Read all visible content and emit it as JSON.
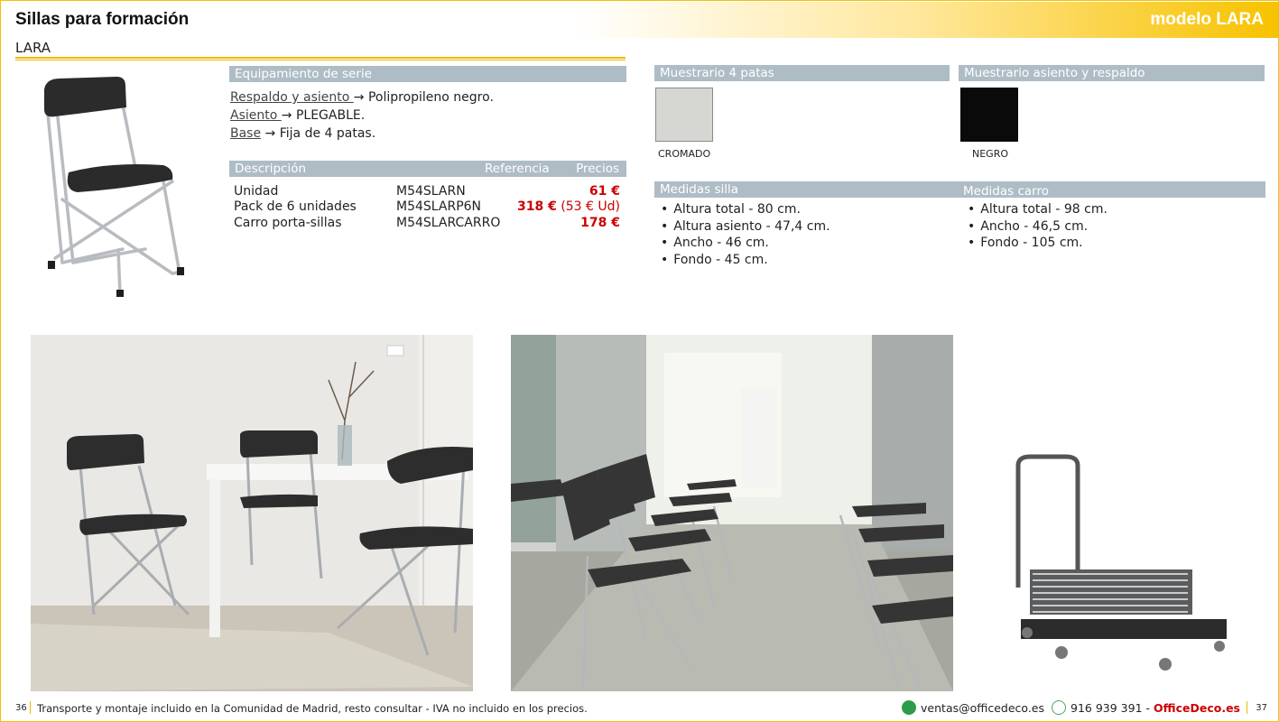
{
  "header": {
    "title": "Sillas para formación",
    "model": "modelo LARA"
  },
  "subtitle": "LARA",
  "equipment": {
    "heading": "Equipamiento de serie",
    "items": [
      {
        "label": "Respaldo y asiento ",
        "arrow": "→",
        "value": "Polipropileno negro."
      },
      {
        "label": "Asiento ",
        "arrow": "→",
        "value": "PLEGABLE."
      },
      {
        "label": "Base",
        "arrow": "→",
        "value": "Fija de 4 patas."
      }
    ]
  },
  "price_table": {
    "headers": {
      "description": "Descripción",
      "reference": "Referencia",
      "prices": "Precios"
    },
    "rows": [
      {
        "description": "Unidad",
        "reference": "M54SLARN",
        "price": "61 €",
        "unit_price": ""
      },
      {
        "description": "Pack de 6 unidades",
        "reference": "M54SLARP6N",
        "price": "318 €",
        "unit_price": "(53 € Ud)"
      },
      {
        "description": "Carro porta-sillas",
        "reference": "M54SLARCARRO",
        "price": "178 €",
        "unit_price": ""
      }
    ]
  },
  "swatches": {
    "legs": {
      "heading": "Muestrario 4 patas",
      "label": "CROMADO",
      "color": "#d6d6d2"
    },
    "seat": {
      "heading": "Muestrario asiento y respaldo",
      "label": "NEGRO",
      "color": "#0a0a0a"
    }
  },
  "measures": {
    "chair": {
      "heading": "Medidas silla",
      "items": [
        {
          "label": "Altura total",
          "value": " - 80 cm."
        },
        {
          "label": "Altura asiento",
          "value": " - 47,4 cm."
        },
        {
          "label": "Ancho",
          "value": " - 46 cm."
        },
        {
          "label": "Fondo",
          "value": " - 45 cm."
        }
      ]
    },
    "cart": {
      "heading": "Medidas carro",
      "items": [
        {
          "label": "Altura total",
          "value": " - 98 cm."
        },
        {
          "label": "Ancho",
          "value": " - 46,5 cm."
        },
        {
          "label": "Fondo",
          "value": " - 105 cm."
        }
      ]
    }
  },
  "footer": {
    "page_left": "36",
    "notice": "Transporte y montaje incluido en la Comunidad de Madrid, resto consultar - IVA no incluido en los precios.",
    "email": "ventas@officedeco.es",
    "phone": "916 939 391",
    "separator": " - ",
    "brand": "OfficeDeco.es",
    "page_right": "37"
  },
  "colors": {
    "accent": "#f2c200",
    "bar": "#aebcc6",
    "price": "#cc0000"
  }
}
